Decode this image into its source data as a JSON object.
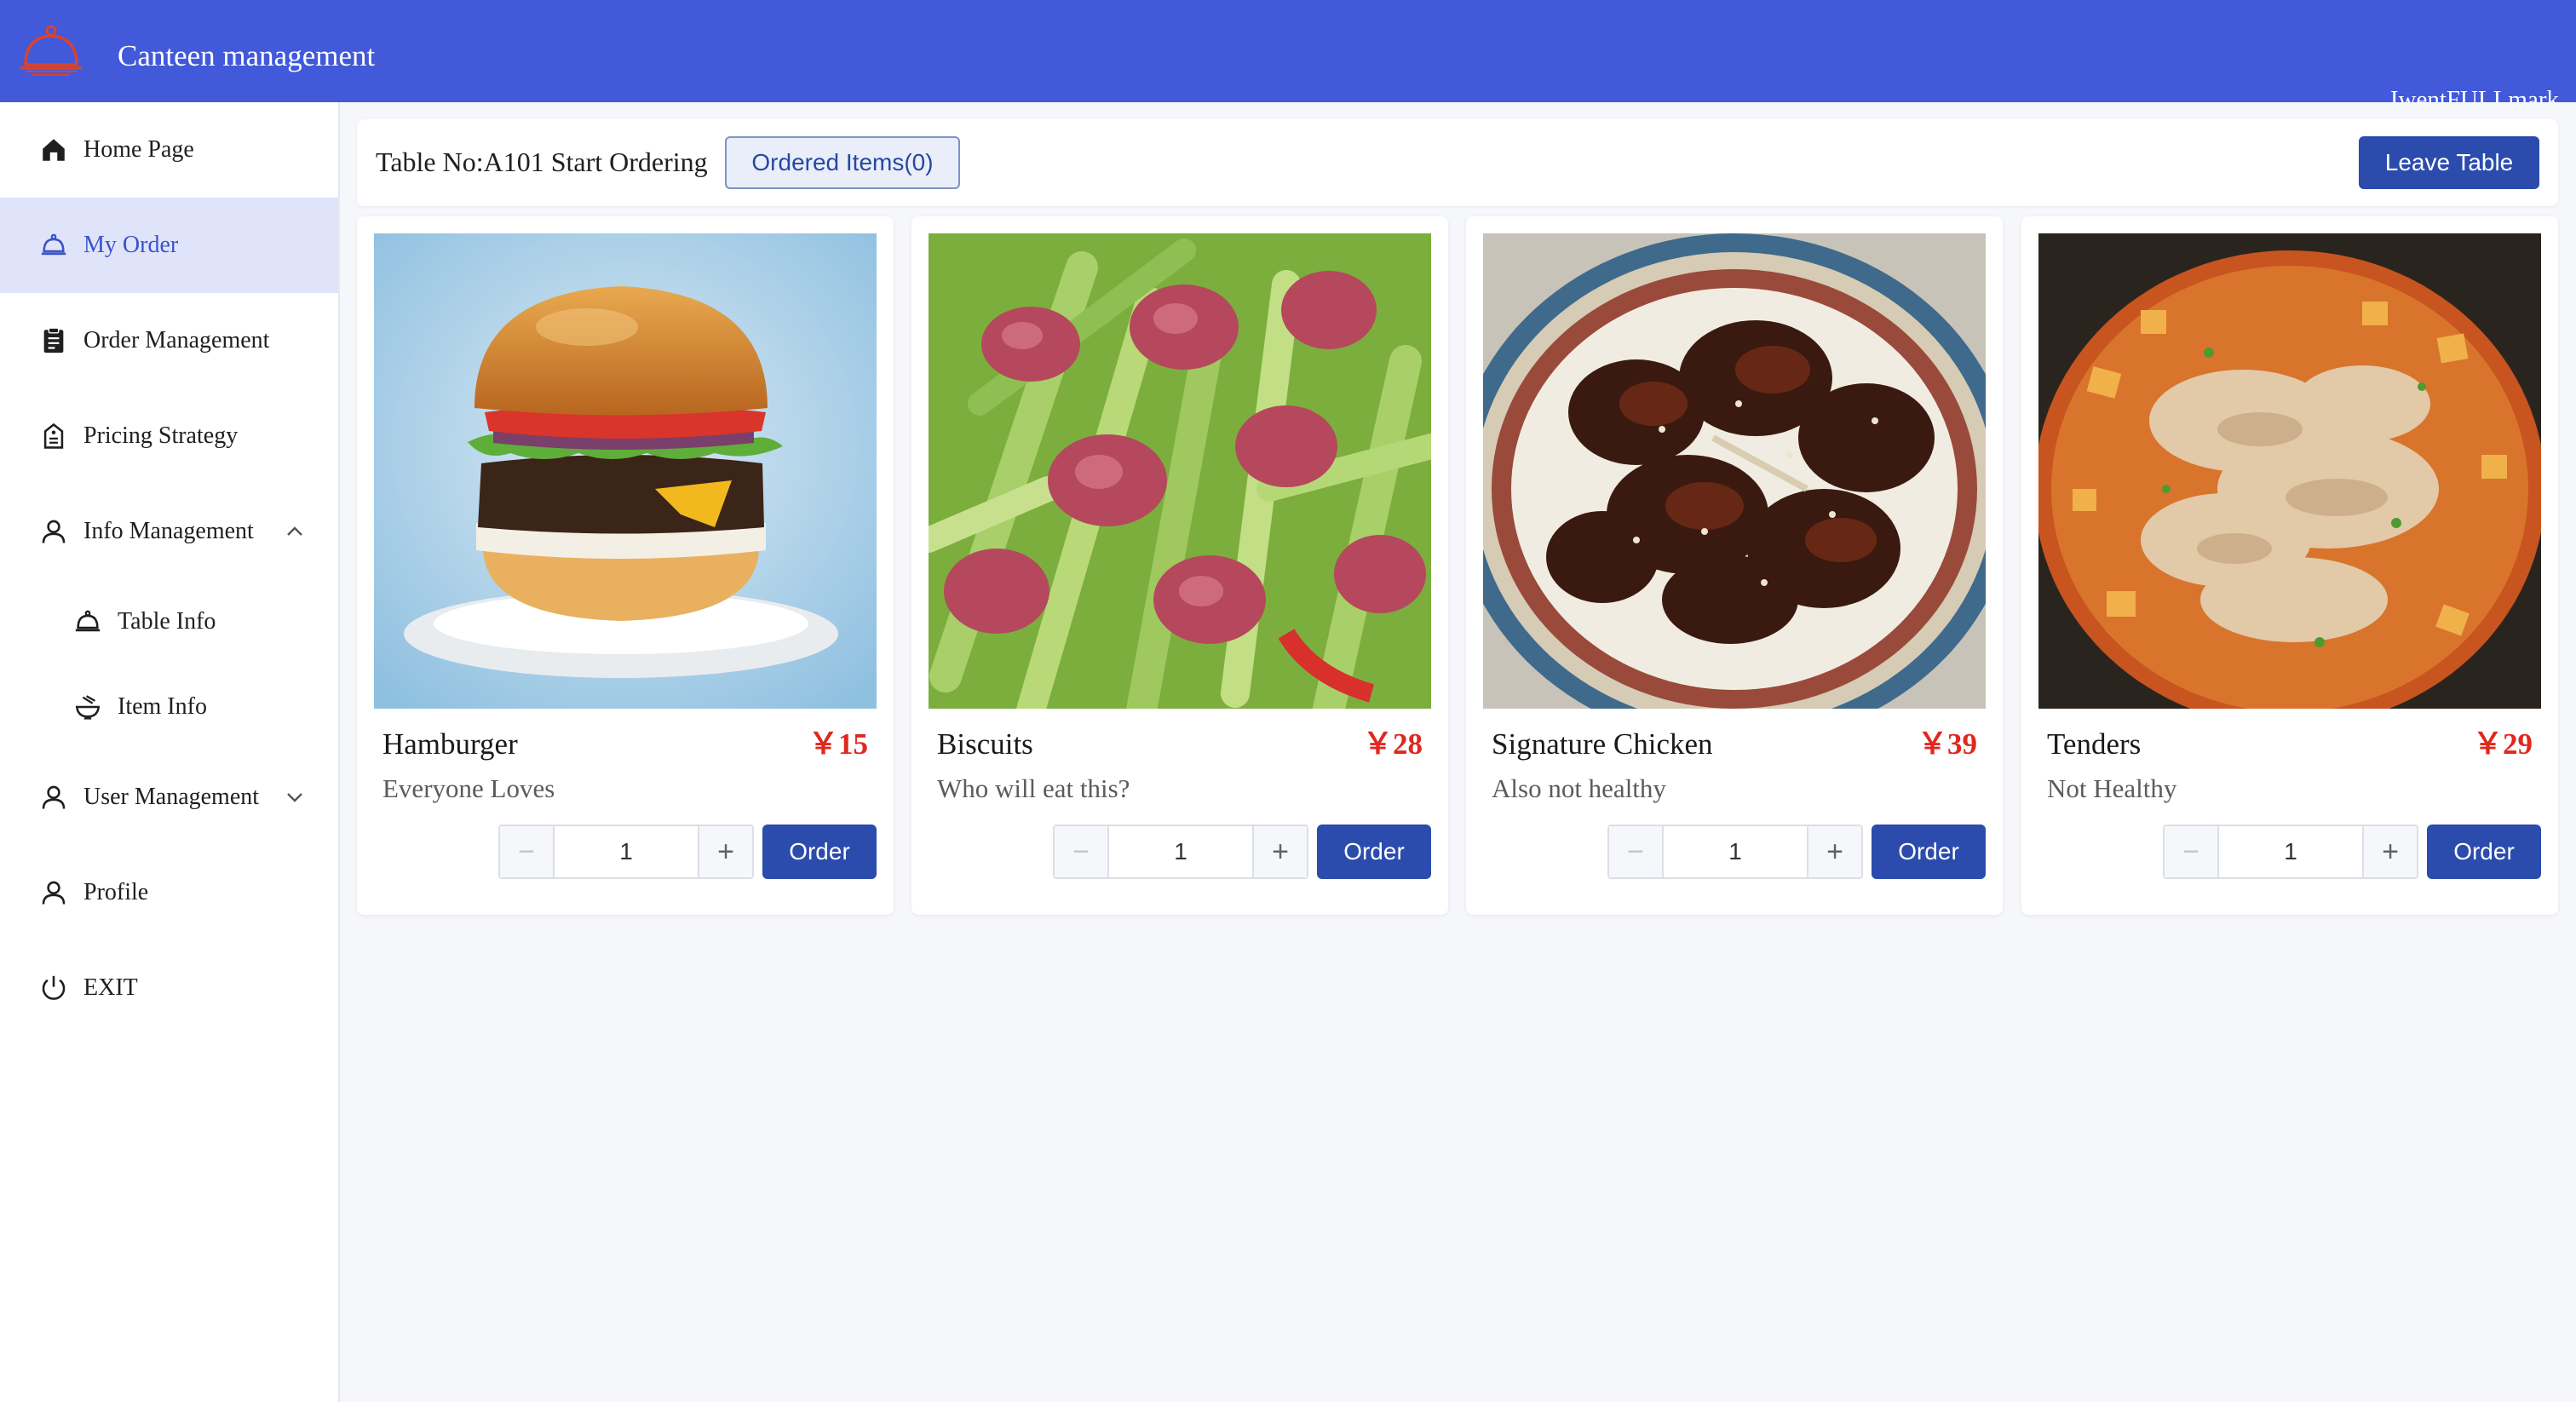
{
  "header": {
    "app_title": "Canteen management",
    "user_name": "IwentFULLmark",
    "accent_color": "#4259d9",
    "logo_icon": "serving-cloche-icon"
  },
  "sidebar": {
    "items": [
      {
        "label": "Home Page",
        "icon": "home-icon"
      },
      {
        "label": "My Order",
        "icon": "cloche-icon",
        "active": true
      },
      {
        "label": "Order Management",
        "icon": "clipboard-icon"
      },
      {
        "label": "Pricing Strategy",
        "icon": "price-tag-icon"
      },
      {
        "label": "Info Management",
        "icon": "user-icon",
        "expanded": true
      },
      {
        "label": "User Management",
        "icon": "user-icon",
        "expanded": false
      },
      {
        "label": "Profile",
        "icon": "user-icon"
      },
      {
        "label": "EXIT",
        "icon": "power-icon"
      }
    ],
    "sub_items": [
      {
        "label": "Table Info",
        "icon": "cloche-icon"
      },
      {
        "label": "Item Info",
        "icon": "bowl-icon"
      }
    ]
  },
  "topbar": {
    "table_label": "Table No:A101 Start Ordering",
    "ordered_items_label": "Ordered Items(0)",
    "leave_label": "Leave Table"
  },
  "items": [
    {
      "name": "Hamburger",
      "price": "￥15",
      "desc": "Everyone Loves",
      "qty": "1",
      "order_label": "Order",
      "image": "hamburger-photo"
    },
    {
      "name": "Biscuits",
      "price": "￥28",
      "desc": "Who will eat this?",
      "qty": "1",
      "order_label": "Order",
      "image": "celery-sausage-photo"
    },
    {
      "name": "Signature Chicken",
      "price": "￥39",
      "desc": "Also not healthy",
      "qty": "1",
      "order_label": "Order",
      "image": "glazed-ribs-photo"
    },
    {
      "name": "Tenders",
      "price": "￥29",
      "desc": "Not Healthy",
      "qty": "1",
      "order_label": "Order",
      "image": "beef-stew-photo"
    }
  ],
  "stepper": {
    "minus_symbol": "−",
    "plus_symbol": "+"
  },
  "colors": {
    "primary_button": "#2b4cad",
    "price": "#e0281f",
    "active_nav_bg": "#dfe4fb"
  }
}
